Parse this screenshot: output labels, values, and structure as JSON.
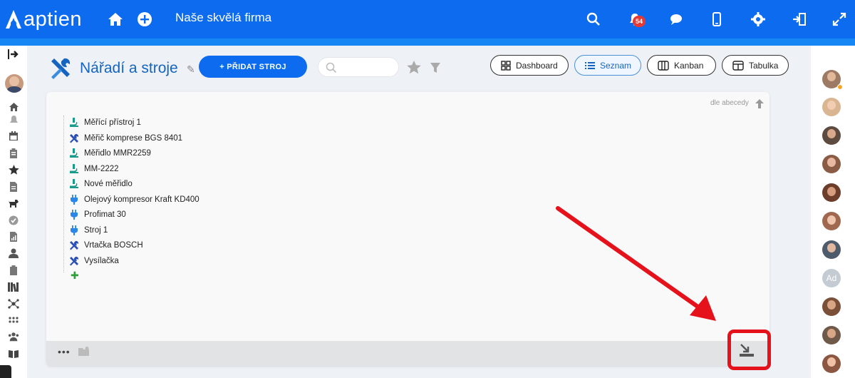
{
  "app": {
    "brand": "aptien",
    "company": "Naše skvělá firma",
    "notifications": "54"
  },
  "topbar_icons": [
    "home-icon",
    "plus-circle-icon",
    "search-icon",
    "bell-icon",
    "chat-icon",
    "mobile-icon",
    "gear-icon",
    "logout-icon",
    "expand-icon"
  ],
  "page": {
    "title": "Nářadí a stroje",
    "add_button": "+ PŘIDAT STROJ",
    "search_placeholder": ""
  },
  "views": [
    {
      "label": "Dashboard",
      "icon": "dashboard-icon",
      "active": false
    },
    {
      "label": "Seznam",
      "icon": "list-icon",
      "active": true
    },
    {
      "label": "Kanban",
      "icon": "kanban-icon",
      "active": false
    },
    {
      "label": "Tabulka",
      "icon": "table-icon",
      "active": false
    }
  ],
  "sort": {
    "label": "dle abecedy"
  },
  "items": [
    {
      "label": "Měřící přístroj 1",
      "icon": "microscope-icon"
    },
    {
      "label": "Měřič komprese BGS 8401",
      "icon": "tools-icon"
    },
    {
      "label": "Měřidlo MMR2259",
      "icon": "microscope-icon"
    },
    {
      "label": "MM-2222",
      "icon": "microscope-icon"
    },
    {
      "label": "Nové měřidlo",
      "icon": "microscope-icon"
    },
    {
      "label": "Olejový kompresor Kraft KD400",
      "icon": "plug-icon"
    },
    {
      "label": "Profimat 30",
      "icon": "plug-icon"
    },
    {
      "label": "Stroj 1",
      "icon": "plug-icon"
    },
    {
      "label": "Vrtačka BOSCH",
      "icon": "tools-icon"
    },
    {
      "label": "Vysílačka",
      "icon": "tools-icon"
    }
  ],
  "footer": {
    "more": "•••"
  },
  "right_avatars": [
    "",
    "",
    "",
    "",
    "",
    "",
    "",
    "Ad",
    "",
    "",
    ""
  ],
  "colors": {
    "primary": "#0c6bef",
    "accent": "#1565c0",
    "highlight": "#e6121b"
  }
}
